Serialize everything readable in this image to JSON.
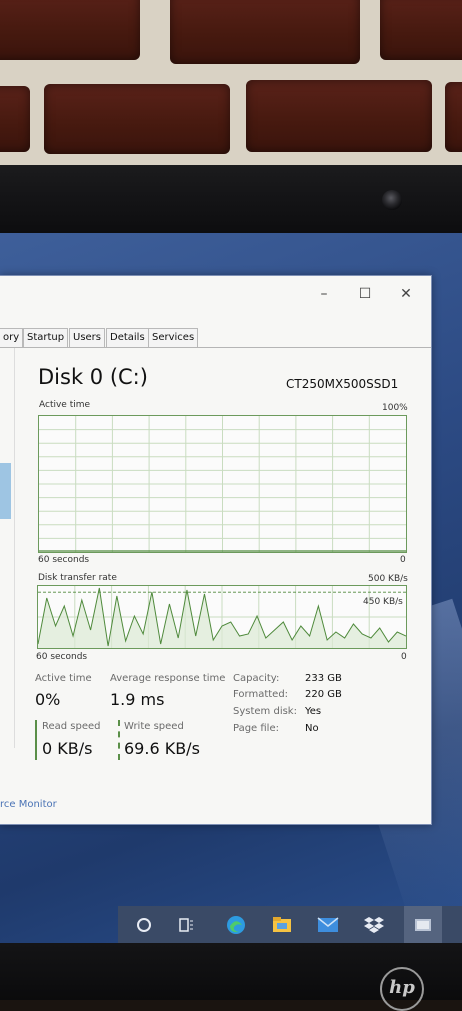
{
  "window": {
    "controls": {
      "minimize": "–",
      "maximize": "☐",
      "close": "✕"
    },
    "tabs": [
      "ory",
      "Startup",
      "Users",
      "Details",
      "Services"
    ]
  },
  "disk": {
    "title": "Disk 0 (C:)",
    "model": "CT250MX500SSD1"
  },
  "active_time_graph": {
    "label": "Active time",
    "max_label": "100%",
    "time_label": "60 seconds",
    "min_label": "0",
    "values_pct": [
      0,
      0,
      0,
      0,
      0,
      0,
      0,
      0,
      0,
      0,
      0,
      0,
      0,
      0,
      0,
      0,
      0,
      0,
      0,
      0,
      0,
      0,
      0,
      0,
      0,
      0,
      0,
      0,
      0,
      0,
      0,
      0,
      0,
      0,
      0,
      0,
      0,
      0,
      0,
      0,
      0,
      0,
      0,
      0,
      0,
      0,
      0,
      0,
      0,
      0,
      0,
      0,
      0,
      0,
      0,
      0,
      0,
      0,
      0,
      0
    ]
  },
  "transfer_graph": {
    "label": "Disk transfer rate",
    "max_label": "500 KB/s",
    "ref_label": "450 KB/s",
    "time_label": "60 seconds",
    "min_label": "0"
  },
  "stats": {
    "active_time": {
      "label": "Active time",
      "value": "0%"
    },
    "avg_response": {
      "label": "Average response time",
      "value": "1.9 ms"
    },
    "read_speed": {
      "label": "Read speed",
      "value": "0 KB/s"
    },
    "write_speed": {
      "label": "Write speed",
      "value": "69.6 KB/s"
    }
  },
  "properties": [
    {
      "label": "Capacity:",
      "value": "233 GB"
    },
    {
      "label": "Formatted:",
      "value": "220 GB"
    },
    {
      "label": "System disk:",
      "value": "Yes"
    },
    {
      "label": "Page file:",
      "value": "No"
    }
  ],
  "resource_monitor_link": "rce Monitor",
  "colors": {
    "graph_border": "#6c9a5c",
    "graph_line": "#4f8a3c",
    "graph_fill": "#dbe9d4",
    "grid": "#c9dcc0"
  },
  "taskbar": {
    "icons": [
      "cortana-circle-icon",
      "task-view-icon",
      "edge-icon",
      "file-explorer-icon",
      "mail-icon",
      "dropbox-icon",
      "tablet-mode-icon"
    ]
  },
  "brand": "hp"
}
